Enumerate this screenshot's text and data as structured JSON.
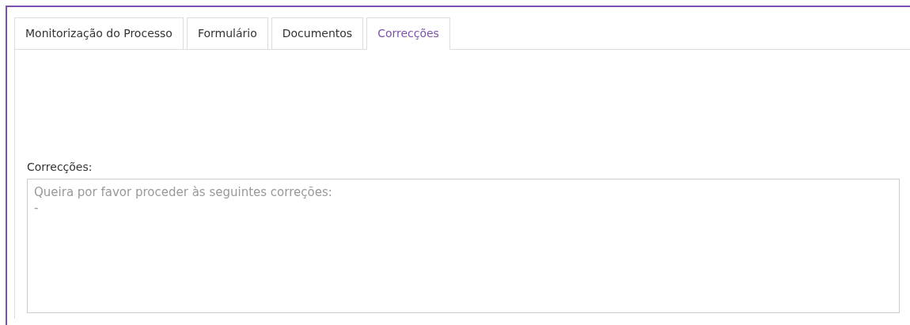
{
  "tabs": [
    {
      "label": "Monitorização do Processo",
      "selected": false
    },
    {
      "label": "Formulário",
      "selected": false
    },
    {
      "label": "Documentos",
      "selected": false
    },
    {
      "label": "Correcções",
      "selected": true
    }
  ],
  "corrections": {
    "label": "Correcções:",
    "placeholder": "Queira por favor proceder às seguintes correções:\n-"
  }
}
